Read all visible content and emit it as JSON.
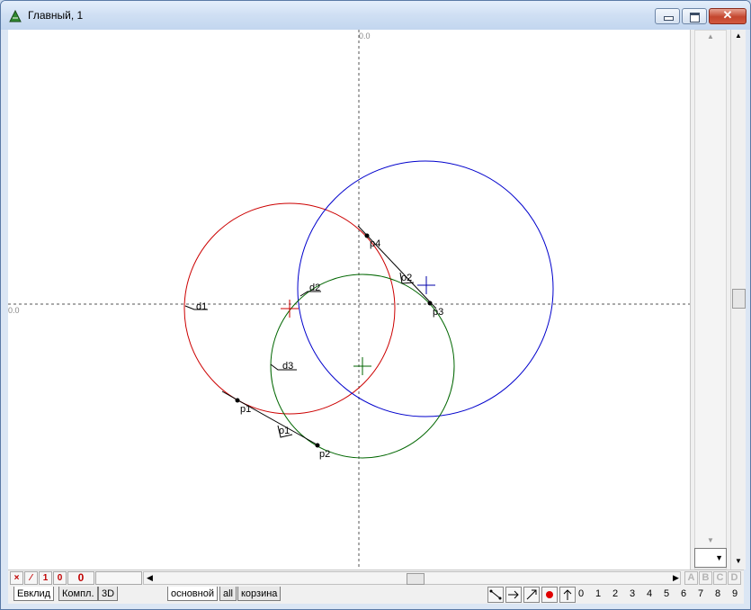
{
  "window": {
    "title": "Главный, 1",
    "colors": {
      "red_circle": "#cc0000",
      "blue_circle": "#0000cc",
      "green_circle": "#006600"
    }
  },
  "canvas": {
    "axis_x_label": "0.0",
    "axis_y_label": "0.0",
    "labels": {
      "p1": "p1",
      "p2": "p2",
      "p3": "p3",
      "p4": "p4",
      "d1": "d1",
      "d2": "d2",
      "d3": "d3",
      "o1": "o1",
      "o2": "o2"
    }
  },
  "status": {
    "btn_x": "×",
    "btn_slash": "⁄",
    "btn_1": "1",
    "btn_0": "0",
    "counter": "0"
  },
  "letters": [
    "A",
    "B",
    "C",
    "D"
  ],
  "tabs_left": [
    "Евклид",
    "Компл.",
    "3D"
  ],
  "tabs_right": [
    "основной",
    "all",
    "корзина"
  ],
  "digits": [
    "0",
    "1",
    "2",
    "3",
    "4",
    "5",
    "6",
    "7",
    "8",
    "9"
  ],
  "icons": {
    "app": "geometry-app-icon",
    "tool_segment": "segment-tool-icon",
    "tool_arrow": "arrow-right-icon",
    "tool_vector": "vector-tool-icon",
    "tool_point": "red-point-icon",
    "tool_up": "arrow-up-icon"
  }
}
